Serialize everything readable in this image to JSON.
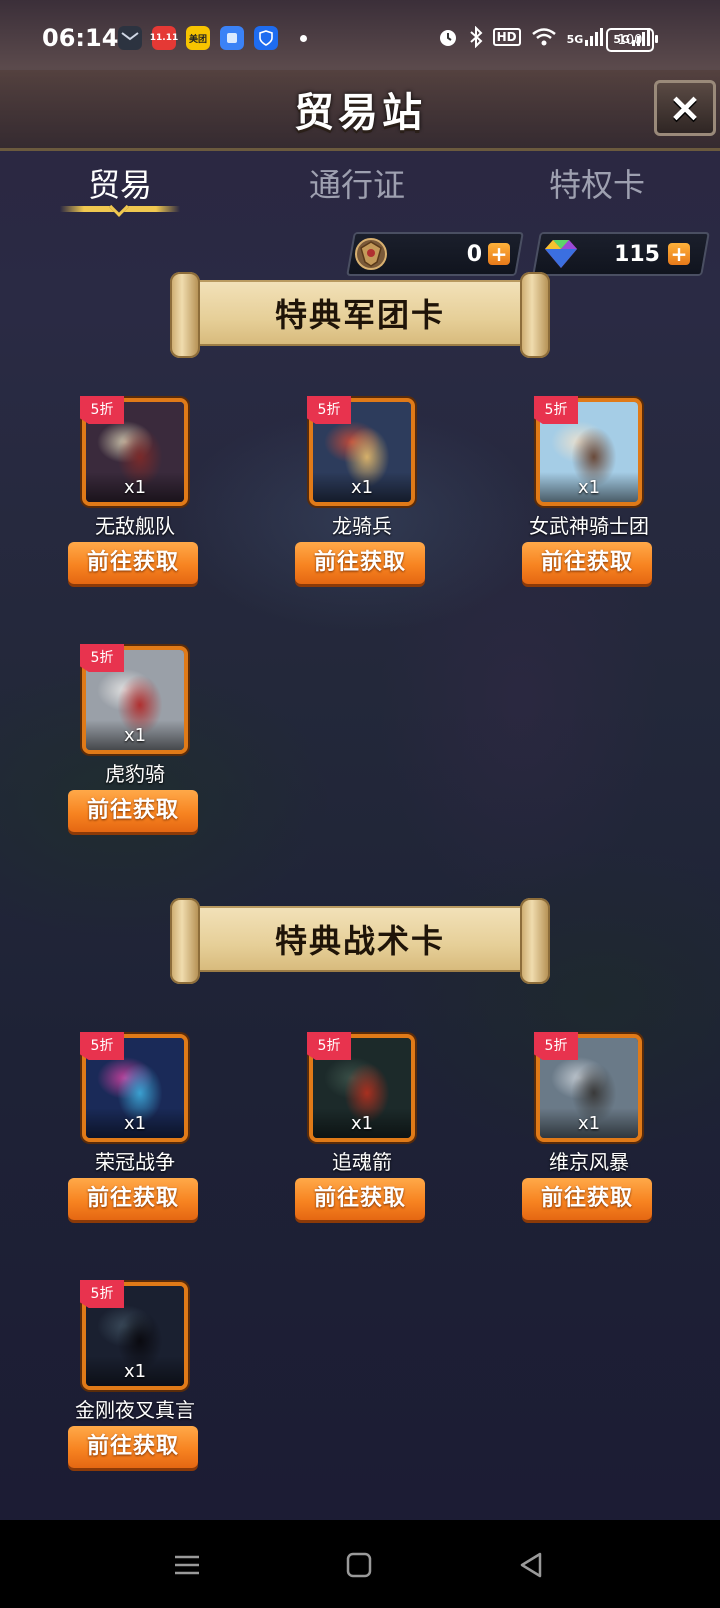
{
  "status_bar": {
    "time": "06:14",
    "apps": [
      {
        "icon": "message-icon",
        "label": "",
        "color": "#2c3340"
      },
      {
        "icon": "shopping-app-icon",
        "label": "11.11",
        "color": "#e53935"
      },
      {
        "icon": "meituan-icon",
        "label": "美团",
        "color": "#f8c400"
      },
      {
        "icon": "app-blue-icon",
        "label": "",
        "color": "#3b82f6"
      },
      {
        "icon": "shield-app-icon",
        "label": "",
        "color": "#1e6cf0"
      }
    ],
    "indicators": [
      "alarm-icon",
      "bluetooth-icon",
      "hd-icon",
      "wifi-icon",
      "5g-signal-icon",
      "5g-signal-icon"
    ],
    "hd_label": "HD",
    "signal_label_1": "5G",
    "signal_label_2": "5G",
    "battery": "100"
  },
  "header": {
    "title": "贸易站",
    "close_icon": "×"
  },
  "tabs": [
    {
      "label": "贸易",
      "active": true
    },
    {
      "label": "通行证",
      "active": false
    },
    {
      "label": "特权卡",
      "active": false
    }
  ],
  "currencies": [
    {
      "icon": "crest-medal-icon",
      "value": "0"
    },
    {
      "icon": "diamond-gem-icon",
      "value": "115"
    }
  ],
  "sections": [
    {
      "title": "特典军团卡",
      "cards": [
        {
          "name": "无敌舰队",
          "badge": "5折",
          "qty": "x1",
          "button": "前往获取",
          "art": "fleet-art",
          "colors": [
            "#3a2a3c",
            "#c8bfa8",
            "#7a2a2a"
          ]
        },
        {
          "name": "龙骑兵",
          "badge": "5折",
          "qty": "x1",
          "button": "前往获取",
          "art": "dragon-rider-art",
          "colors": [
            "#2d3c5c",
            "#c04a3a",
            "#d6b06a"
          ]
        },
        {
          "name": "女武神骑士团",
          "badge": "5折",
          "qty": "x1",
          "button": "前往获取",
          "art": "valkyrie-art",
          "colors": [
            "#a5cde6",
            "#e8e0d0",
            "#6a4a3a"
          ]
        },
        {
          "name": "虎豹骑",
          "badge": "5折",
          "qty": "x1",
          "button": "前往获取",
          "art": "cavalry-art",
          "colors": [
            "#9aa0a8",
            "#e0e0e0",
            "#b03030"
          ]
        }
      ]
    },
    {
      "title": "特典战术卡",
      "cards": [
        {
          "name": "荣冠战争",
          "badge": "5折",
          "qty": "x1",
          "button": "前往获取",
          "art": "crown-war-art",
          "colors": [
            "#1a2a58",
            "#c0409a",
            "#3aa0d0"
          ]
        },
        {
          "name": "追魂箭",
          "badge": "5折",
          "qty": "x1",
          "button": "前往获取",
          "art": "soul-arrow-art",
          "colors": [
            "#1c2a2a",
            "#3a5048",
            "#a83020"
          ]
        },
        {
          "name": "维京风暴",
          "badge": "5折",
          "qty": "x1",
          "button": "前往获取",
          "art": "viking-art",
          "colors": [
            "#6a7a88",
            "#c0c8d0",
            "#3a3a3a"
          ]
        },
        {
          "name": "金刚夜叉真言",
          "badge": "5折",
          "qty": "x1",
          "button": "前往获取",
          "art": "vajra-art",
          "colors": [
            "#1a2030",
            "#3a4a5a",
            "#0a0a10"
          ]
        }
      ]
    }
  ],
  "nav": [
    "menu-icon",
    "home-icon",
    "back-icon"
  ]
}
